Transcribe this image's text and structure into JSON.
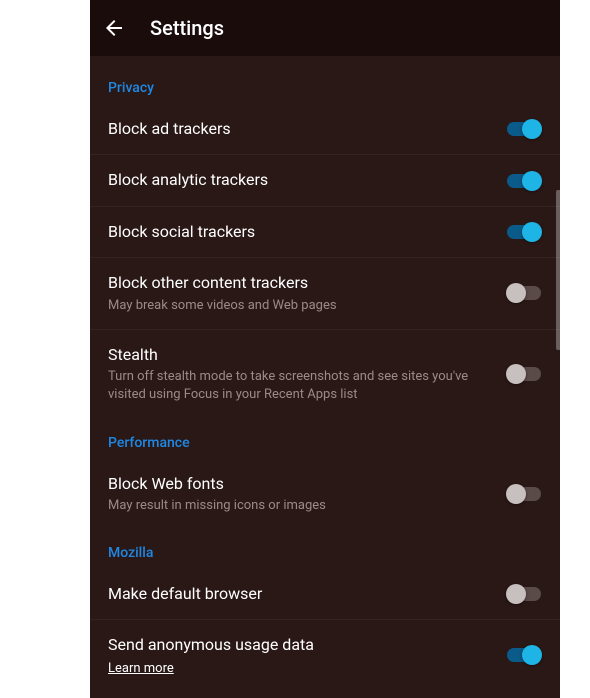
{
  "appBar": {
    "title": "Settings"
  },
  "sections": {
    "privacy": {
      "header": "Privacy",
      "items": {
        "blockAdTrackers": {
          "title": "Block ad trackers",
          "on": true
        },
        "blockAnalyticTrackers": {
          "title": "Block analytic trackers",
          "on": true
        },
        "blockSocialTrackers": {
          "title": "Block social trackers",
          "on": true
        },
        "blockOtherContentTrackers": {
          "title": "Block other content trackers",
          "subtitle": "May break some videos and Web pages",
          "on": false
        },
        "stealth": {
          "title": "Stealth",
          "subtitle": "Turn off stealth mode to take screenshots and see sites you've visited using Focus in your Recent Apps list",
          "on": false
        }
      }
    },
    "performance": {
      "header": "Performance",
      "items": {
        "blockWebFonts": {
          "title": "Block Web fonts",
          "subtitle": "May result in missing icons or images",
          "on": false
        }
      }
    },
    "mozilla": {
      "header": "Mozilla",
      "items": {
        "makeDefaultBrowser": {
          "title": "Make default browser",
          "on": false
        },
        "sendAnonymousUsageData": {
          "title": "Send anonymous usage data",
          "link": "Learn more",
          "on": true
        }
      }
    }
  }
}
